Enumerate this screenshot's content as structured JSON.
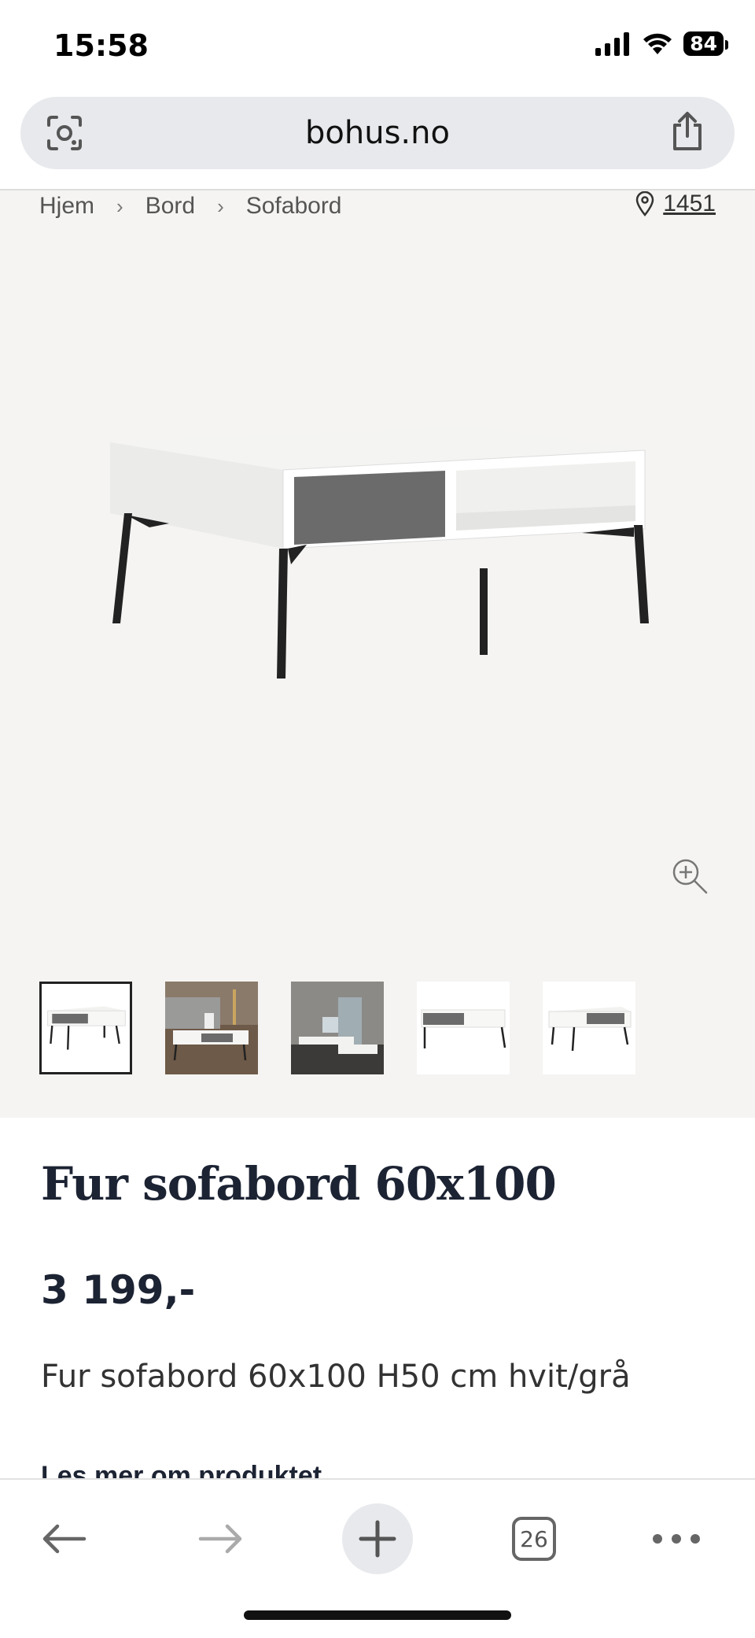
{
  "status": {
    "time": "15:58",
    "battery": "84"
  },
  "browser": {
    "url": "bohus.no",
    "tab_count": "26"
  },
  "breadcrumb": {
    "items": [
      "Hjem",
      "Bord",
      "Sofabord"
    ],
    "store": "1451"
  },
  "product": {
    "title": "Fur sofabord 60x100",
    "price": "3 199,-",
    "description": "Fur sofabord 60x100 H50 cm hvit/grå",
    "read_more": "Les mer om produktet"
  },
  "icons": {
    "url_left": "lens-camera-icon",
    "url_right": "share-icon",
    "zoom": "zoom-in-icon",
    "store": "location-pin-icon"
  },
  "colors": {
    "accent_text": "#1c2333",
    "product_bg": "#f5f4f2",
    "url_bar_bg": "#e7e9ec"
  }
}
